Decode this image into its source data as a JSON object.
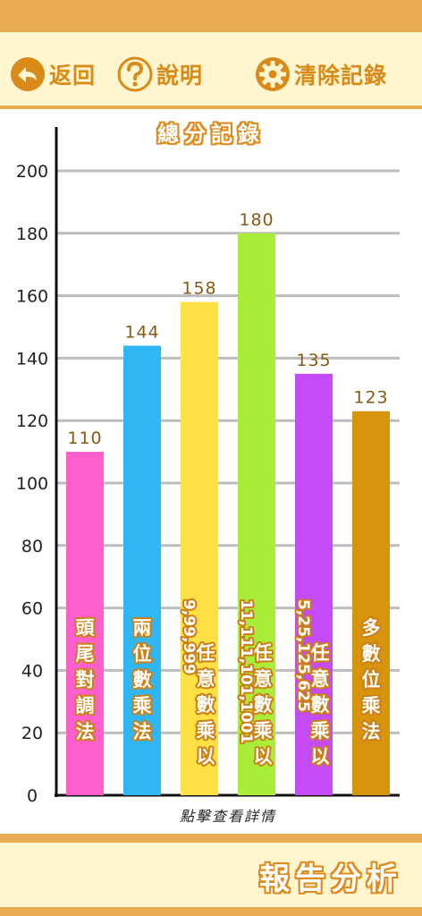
{
  "toolbar": {
    "back_label": "返回",
    "help_label": "說明",
    "clear_label": "清除記錄"
  },
  "icons": [
    "back-arrow-icon",
    "question-icon",
    "gear-icon"
  ],
  "colors": {
    "accent": "#e8ab50",
    "accent_dark": "#d98a18",
    "panel": "#fff6cf"
  },
  "chart_data": {
    "type": "bar",
    "title": "總分記錄",
    "xlabel": "點擊查看詳情",
    "ylim": [
      0,
      200
    ],
    "yticks": [
      0,
      20,
      40,
      60,
      80,
      100,
      120,
      140,
      160,
      180,
      200
    ],
    "grid": true,
    "categories": [
      {
        "label": "頭尾對調法",
        "sub": "",
        "value": 110,
        "color": "#ff5fcc"
      },
      {
        "label": "兩位數乘法",
        "sub": "",
        "value": 144,
        "color": "#2eb6f5"
      },
      {
        "label": "任意數乘以",
        "sub": "9,99,999",
        "value": 158,
        "color": "#ffe045"
      },
      {
        "label": "任意數乘以",
        "sub": "11,111,101,1001",
        "value": 180,
        "color": "#a9ec3a"
      },
      {
        "label": "任意數乘以",
        "sub": "5,25,125,625",
        "value": 135,
        "color": "#c34cf7"
      },
      {
        "label": "多數位乘法",
        "sub": "",
        "value": 123,
        "color": "#d8940c"
      }
    ]
  },
  "footer": {
    "title": "報告分析"
  }
}
